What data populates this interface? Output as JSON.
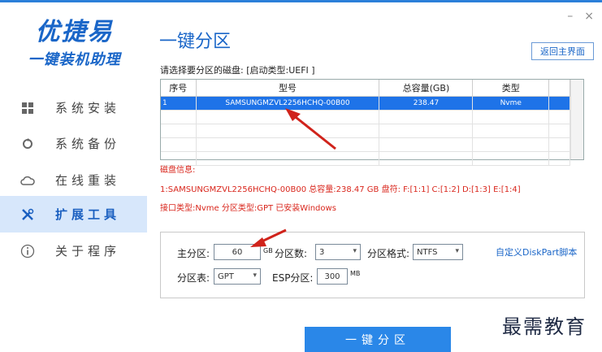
{
  "app": {
    "name": "优捷易",
    "subtitle": "一键装机助理"
  },
  "window": {
    "minimize": "–",
    "close": "×"
  },
  "sidebar": {
    "items": [
      {
        "label": "系统安装",
        "icon": "windows-icon"
      },
      {
        "label": "系统备份",
        "icon": "backup-icon"
      },
      {
        "label": "在线重装",
        "icon": "cloud-icon"
      },
      {
        "label": "扩展工具",
        "icon": "tools-icon",
        "active": true
      },
      {
        "label": "关于程序",
        "icon": "info-icon"
      }
    ]
  },
  "main": {
    "title": "一键分区",
    "back_label": "返回主界面",
    "disk_hint": "请选择要分区的磁盘: [启动类型:UEFI ]",
    "table": {
      "headers": [
        "序号",
        "型号",
        "总容量(GB)",
        "类型"
      ],
      "rows": [
        [
          "1",
          "SAMSUNGMZVL2256HCHQ-00B00",
          "238.47",
          "Nvme"
        ]
      ]
    },
    "disk_info": {
      "label": "磁盘信息:",
      "line1": "1:SAMSUNGMZVL2256HCHQ-00B00  总容量:238.47 GB  盘符: F:[1:1] C:[1:2] D:[1:3] E:[1:4]",
      "line2": "接口类型:Nvme  分区类型:GPT 已安装Windows"
    },
    "settings": {
      "primary_label": "主分区:",
      "primary_value": "60",
      "primary_unit": "GB",
      "count_label": "分区数:",
      "count_value": "3",
      "format_label": "分区格式:",
      "format_value": "NTFS",
      "custom_script": "自定义DiskPart脚本",
      "table_label": "分区表:",
      "table_value": "GPT",
      "esp_label": "ESP分区:",
      "esp_value": "300",
      "esp_unit": "MB"
    },
    "action_label": "一键分区"
  },
  "watermark": "最需教育",
  "colors": {
    "accent": "#1a66c8",
    "selection": "#1e73e8",
    "info_red": "#d9261c",
    "annotation_arrow": "#d0231b"
  }
}
